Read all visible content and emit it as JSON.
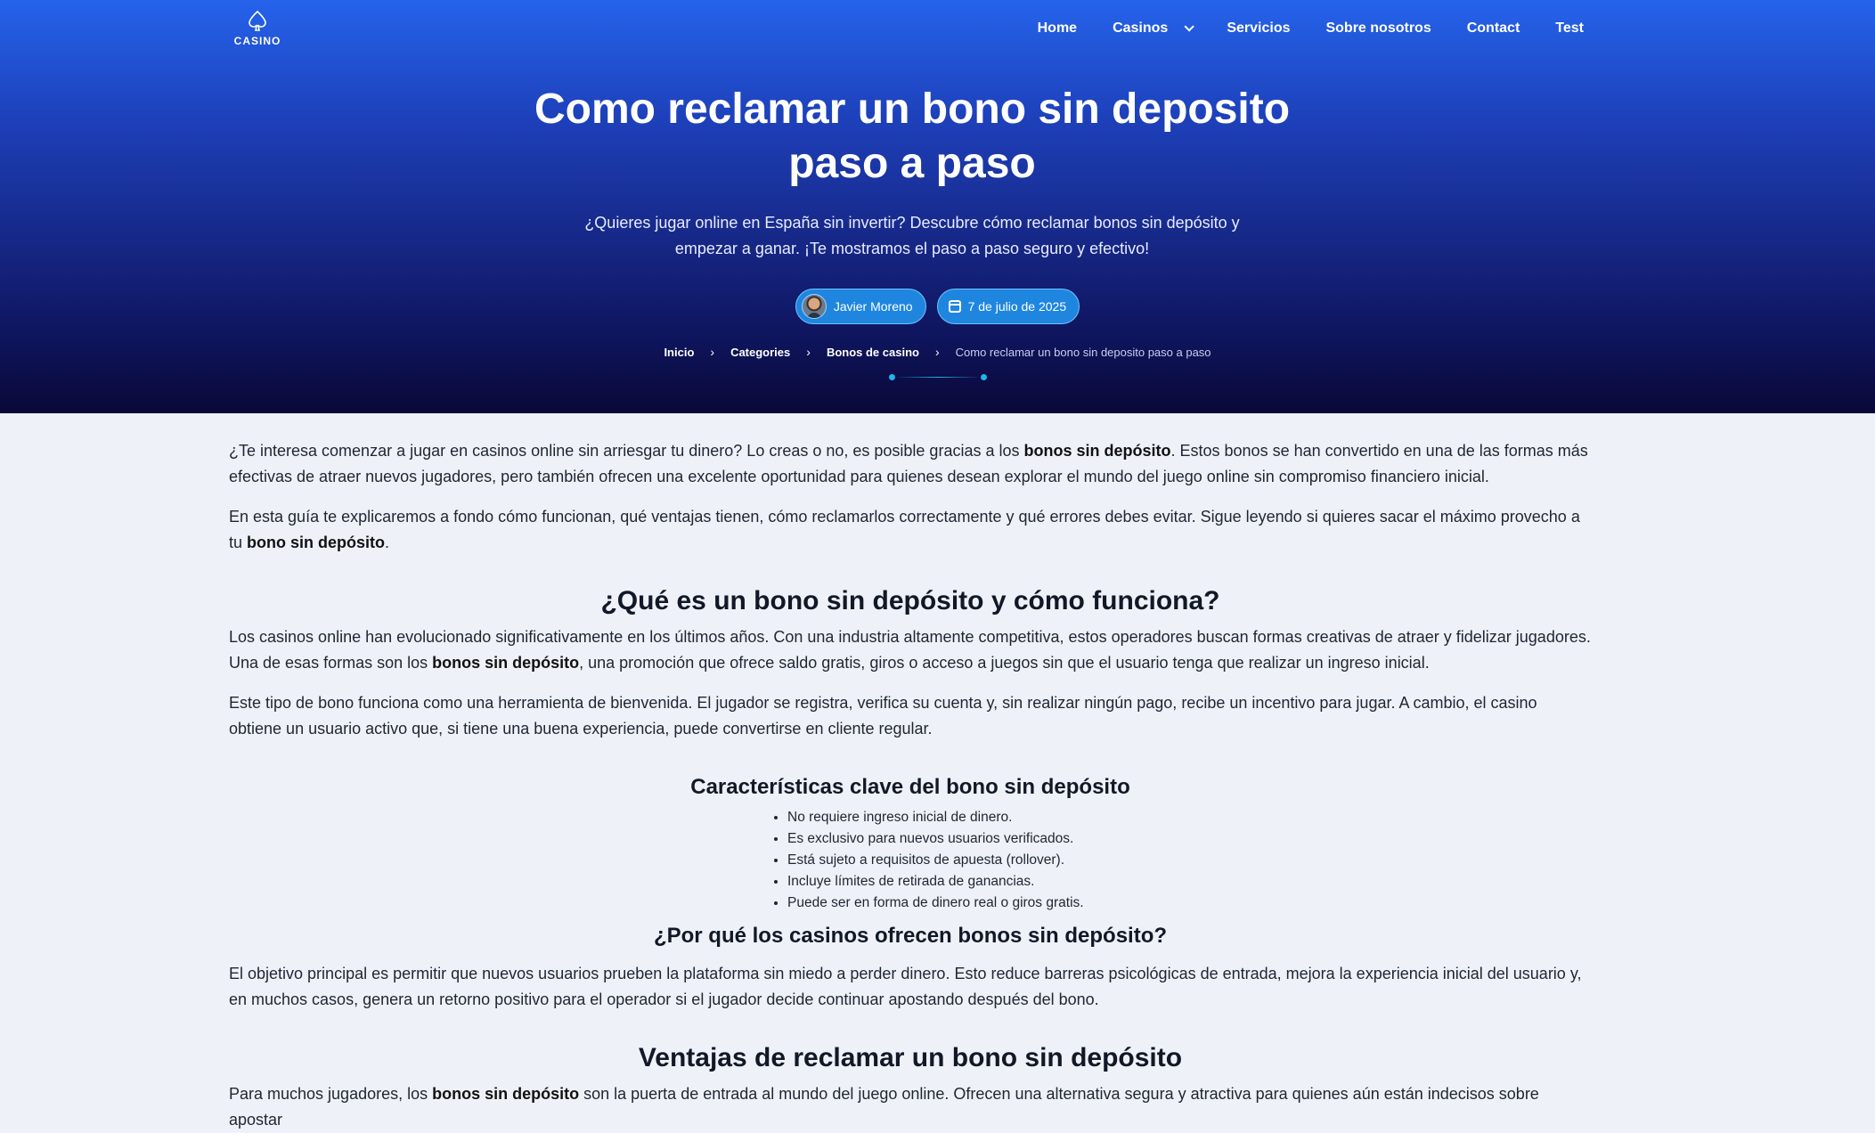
{
  "logo": {
    "text": "CASINO"
  },
  "nav": {
    "items": [
      "Home",
      "Casinos",
      "Servicios",
      "Sobre nosotros",
      "Contact",
      "Test"
    ]
  },
  "hero": {
    "title": "Como reclamar un bono sin deposito paso a paso",
    "subtitle": "¿Quieres jugar online en España sin invertir? Descubre cómo reclamar bonos sin depósito y empezar a ganar. ¡Te mostramos el paso a paso seguro y efectivo!",
    "author": "Javier Moreno",
    "date": "7 de julio de 2025"
  },
  "breadcrumb": {
    "items": [
      "Inicio",
      "Categories",
      "Bonos de casino"
    ],
    "current": "Como reclamar un bono sin deposito paso a paso"
  },
  "article": {
    "intro1_a": "¿Te interesa comenzar a jugar en casinos online sin arriesgar tu dinero? Lo creas o no, es posible gracias a los ",
    "intro1_b": "bonos sin depósito",
    "intro1_c": ". Estos bonos se han convertido en una de las formas más efectivas de atraer nuevos jugadores, pero también ofrecen una excelente oportunidad para quienes desean explorar el mundo del juego online sin compromiso financiero inicial.",
    "intro2_a": "En esta guía te explicaremos a fondo cómo funcionan, qué ventajas tienen, cómo reclamarlos correctamente y qué errores debes evitar. Sigue leyendo si quieres sacar el máximo provecho a tu ",
    "intro2_b": "bono sin depósito",
    "intro2_c": ".",
    "h2_1": "¿Qué es un bono sin depósito y cómo funciona?",
    "p3_a": "Los casinos online han evolucionado significativamente en los últimos años. Con una industria altamente competitiva, estos operadores buscan formas creativas de atraer y fidelizar jugadores. Una de esas formas son los ",
    "p3_b": "bonos sin depósito",
    "p3_c": ", una promoción que ofrece saldo gratis, giros o acceso a juegos sin que el usuario tenga que realizar un ingreso inicial.",
    "p4": "Este tipo de bono funciona como una herramienta de bienvenida. El jugador se registra, verifica su cuenta y, sin realizar ningún pago, recibe un incentivo para jugar. A cambio, el casino obtiene un usuario activo que, si tiene una buena experiencia, puede convertirse en cliente regular.",
    "h3_1": "Características clave del bono sin depósito",
    "list": [
      "No requiere ingreso inicial de dinero.",
      "Es exclusivo para nuevos usuarios verificados.",
      "Está sujeto a requisitos de apuesta (rollover).",
      "Incluye límites de retirada de ganancias.",
      "Puede ser en forma de dinero real o giros gratis."
    ],
    "h3_2": "¿Por qué los casinos ofrecen bonos sin depósito?",
    "p5": "El objetivo principal es permitir que nuevos usuarios prueben la plataforma sin miedo a perder dinero. Esto reduce barreras psicológicas de entrada, mejora la experiencia inicial del usuario y, en muchos casos, genera un retorno positivo para el operador si el jugador decide continuar apostando después del bono.",
    "h2_2": "Ventajas de reclamar un bono sin depósito",
    "p6_a": "Para muchos jugadores, los ",
    "p6_b": "bonos sin depósito",
    "p6_c": " son la puerta de entrada al mundo del juego online. Ofrecen una alternativa segura y atractiva para quienes aún están indecisos sobre apostar"
  },
  "colors": {
    "hero_top": "#2563eb",
    "hero_bottom": "#0a0838",
    "accent": "#1fb6e8",
    "page_bg": "#eef2f8"
  }
}
